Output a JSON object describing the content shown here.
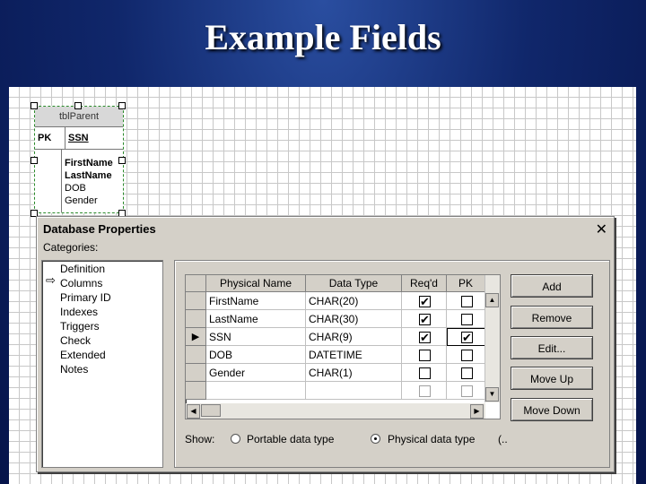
{
  "slide": {
    "title": "Example Fields"
  },
  "entity": {
    "name": "tblParent",
    "pk_label": "PK",
    "pk_column": "SSN",
    "attributes": [
      {
        "name": "FirstName",
        "bold": true
      },
      {
        "name": "LastName",
        "bold": true
      },
      {
        "name": "DOB",
        "bold": false
      },
      {
        "name": "Gender",
        "bold": false
      }
    ]
  },
  "dialog": {
    "title": "Database Properties",
    "close_glyph": "✕",
    "categories_label": "Categories:",
    "categories": [
      "Definition",
      "Columns",
      "Primary ID",
      "Indexes",
      "Triggers",
      "Check",
      "Extended",
      "Notes"
    ],
    "selected_category": "Columns",
    "grid": {
      "headers": [
        "Physical Name",
        "Data Type",
        "Req'd",
        "PK"
      ],
      "rows": [
        {
          "name": "FirstName",
          "type": "CHAR(20)",
          "reqd": true,
          "pk": false
        },
        {
          "name": "LastName",
          "type": "CHAR(30)",
          "reqd": true,
          "pk": false
        },
        {
          "name": "SSN",
          "type": "CHAR(9)",
          "reqd": true,
          "pk": true,
          "current": true
        },
        {
          "name": "DOB",
          "type": "DATETIME",
          "reqd": false,
          "pk": false
        },
        {
          "name": "Gender",
          "type": "CHAR(1)",
          "reqd": false,
          "pk": false
        }
      ],
      "current_row_marker": "▶"
    },
    "buttons": {
      "add": "Add",
      "remove": "Remove",
      "edit": "Edit...",
      "move_up": "Move Up",
      "move_down": "Move Down"
    },
    "show": {
      "label": "Show:",
      "portable": "Portable data type",
      "physical": "Physical data type",
      "selected": "physical",
      "trailing": "(.."
    }
  },
  "icons": {
    "close": "close-icon",
    "category_arrow": "arrow-right-icon",
    "check": "check-icon"
  }
}
